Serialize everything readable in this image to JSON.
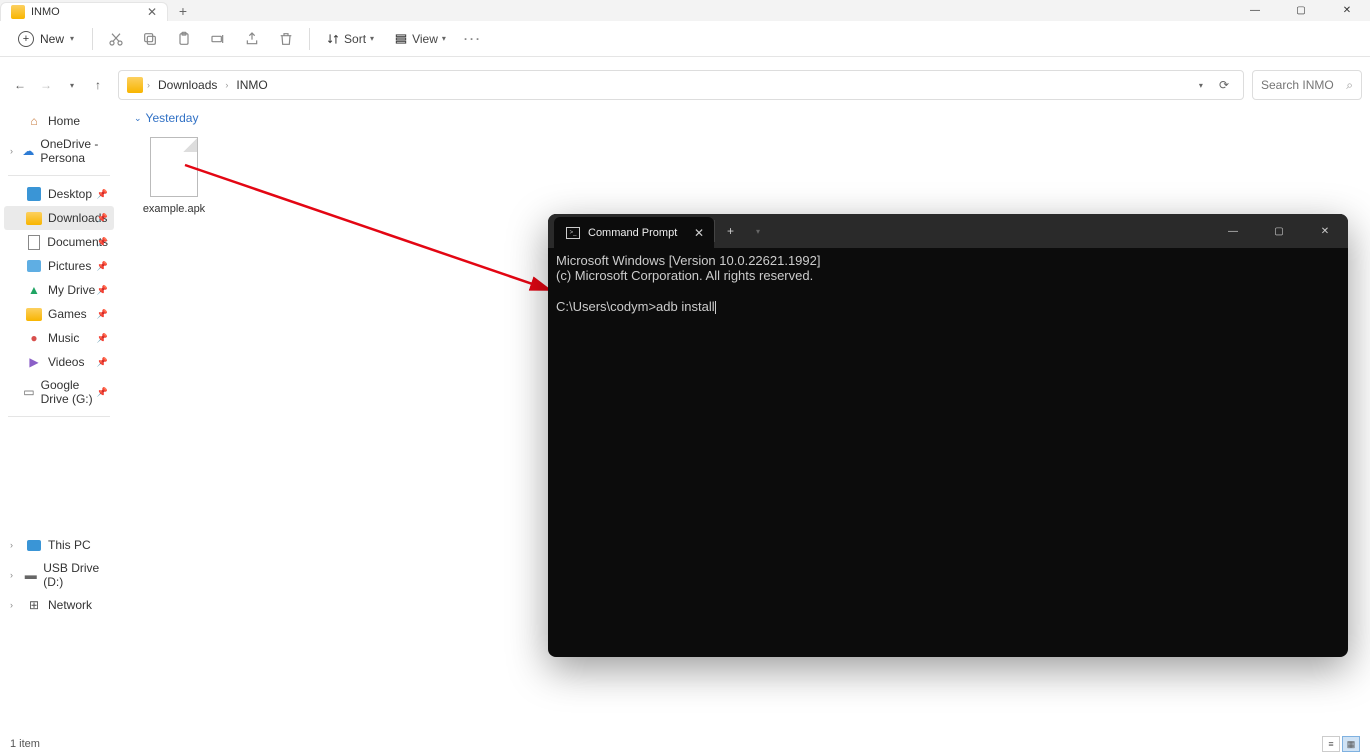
{
  "window": {
    "tab_title": "INMO",
    "controls": {
      "minimize": "—",
      "maximize": "▢",
      "close": "✕"
    }
  },
  "toolbar": {
    "new_label": "New",
    "sort_label": "Sort",
    "view_label": "View"
  },
  "breadcrumbs": [
    "Downloads",
    "INMO"
  ],
  "search": {
    "placeholder": "Search INMO"
  },
  "sidebar": {
    "home": "Home",
    "onedrive": "OneDrive - Persona",
    "quick": [
      {
        "label": "Desktop",
        "icon": "desktop"
      },
      {
        "label": "Downloads",
        "icon": "folder",
        "active": true
      },
      {
        "label": "Documents",
        "icon": "document"
      },
      {
        "label": "Pictures",
        "icon": "picture"
      },
      {
        "label": "My Drive",
        "icon": "gdrive"
      },
      {
        "label": "Games",
        "icon": "folder"
      },
      {
        "label": "Music",
        "icon": "music"
      },
      {
        "label": "Videos",
        "icon": "video"
      },
      {
        "label": "Google Drive (G:)",
        "icon": "drive"
      }
    ],
    "bottom": [
      {
        "label": "This PC",
        "icon": "pc",
        "chevron": true
      },
      {
        "label": "USB Drive (D:)",
        "icon": "usb",
        "chevron": true
      },
      {
        "label": "Network",
        "icon": "network",
        "chevron": true
      }
    ]
  },
  "content": {
    "group": "Yesterday",
    "files": [
      {
        "name": "example.apk"
      }
    ]
  },
  "status": {
    "text": "1 item"
  },
  "cmd": {
    "title": "Command Prompt",
    "lines": [
      "Microsoft Windows [Version 10.0.22621.1992]",
      "(c) Microsoft Corporation. All rights reserved.",
      "",
      "C:\\Users\\codym>adb install"
    ]
  }
}
